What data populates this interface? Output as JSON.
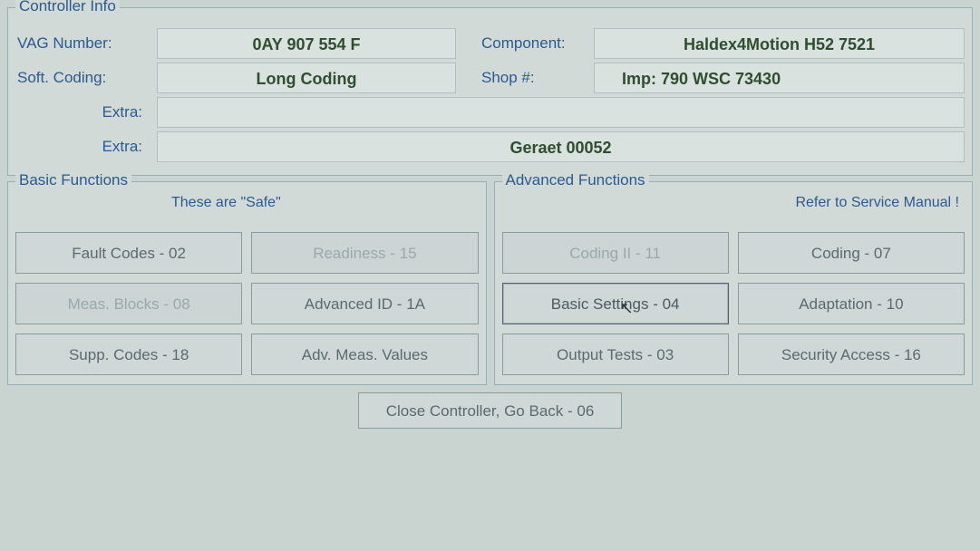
{
  "info": {
    "title": "Controller Info",
    "vag_label": "VAG Number:",
    "vag_value": "0AY 907 554 F",
    "component_label": "Component:",
    "component_value": "Haldex4Motion H52 7521",
    "coding_label": "Soft. Coding:",
    "coding_value": "Long Coding",
    "shop_label": "Shop #:",
    "shop_value": "Imp: 790     WSC 73430",
    "extra1_label": "Extra:",
    "extra1_value": "",
    "extra2_label": "Extra:",
    "extra2_value": "Geraet 00052"
  },
  "basic": {
    "title": "Basic Functions",
    "note": "These are \"Safe\"",
    "fault_codes": "Fault Codes - 02",
    "readiness": "Readiness - 15",
    "meas_blocks": "Meas. Blocks - 08",
    "adv_id": "Advanced ID - 1A",
    "supp_codes": "Supp. Codes - 18",
    "adv_meas": "Adv. Meas. Values"
  },
  "advanced": {
    "title": "Advanced Functions",
    "note": "Refer to Service Manual !",
    "coding2": "Coding II - 11",
    "coding": "Coding - 07",
    "basic_settings": "Basic Settings - 04",
    "adaptation": "Adaptation - 10",
    "output_tests": "Output Tests - 03",
    "security": "Security Access - 16"
  },
  "close": "Close Controller, Go Back - 06"
}
